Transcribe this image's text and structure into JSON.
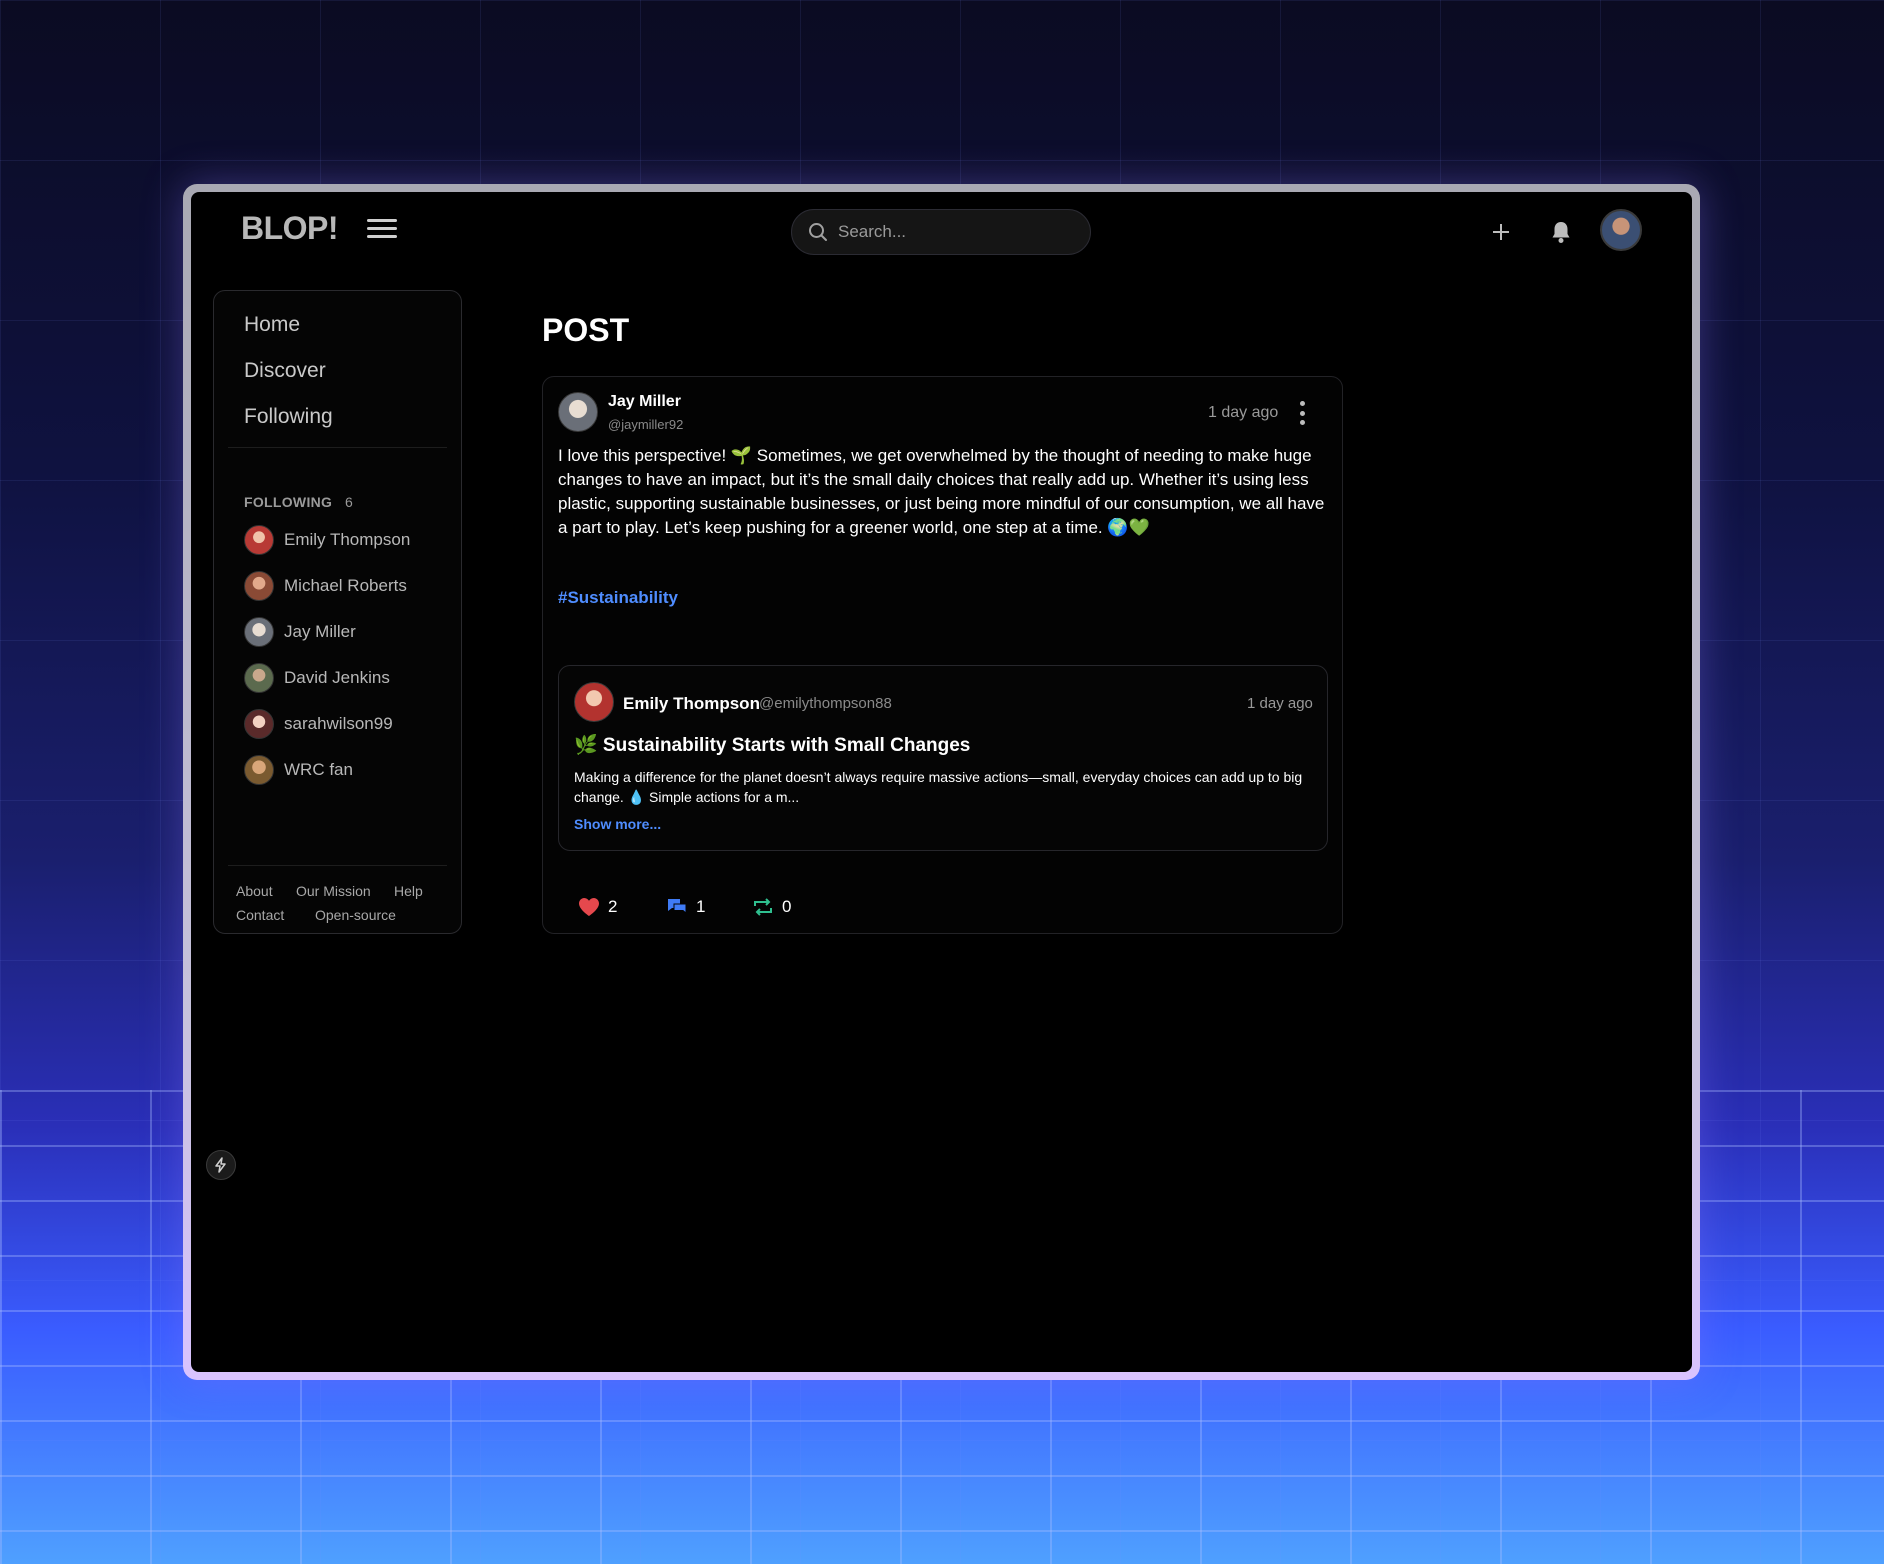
{
  "app": {
    "logo": "BLOP!"
  },
  "search": {
    "placeholder": "Search..."
  },
  "nav": {
    "items": [
      {
        "label": "Home"
      },
      {
        "label": "Discover"
      },
      {
        "label": "Following"
      }
    ]
  },
  "following": {
    "heading": "FOLLOWING",
    "count": "6",
    "users": [
      {
        "name": "Emily Thompson"
      },
      {
        "name": "Michael Roberts"
      },
      {
        "name": "Jay Miller"
      },
      {
        "name": "David Jenkins"
      },
      {
        "name": "sarahwilson99"
      },
      {
        "name": "WRC fan"
      }
    ]
  },
  "footer": {
    "links": [
      "About",
      "Our Mission",
      "Help",
      "Contact",
      "Open-source"
    ]
  },
  "page": {
    "title": "POST"
  },
  "post": {
    "author": "Jay Miller",
    "handle": "@jaymiller92",
    "time": "1 day ago",
    "body": "I love this perspective! 🌱 Sometimes, we get overwhelmed by the thought of needing to make huge changes to have an impact, but it’s the small daily choices that really add up. Whether it’s using less plastic, supporting sustainable businesses, or just being more mindful of our consumption, we all have a part to play. Let’s keep pushing for a greener world, one step at a time. 🌍💚",
    "hashtag": "#Sustainability",
    "quoted": {
      "author": "Emily Thompson",
      "handle": "@emilythompson88",
      "time": "1 day ago",
      "title": "🌿 Sustainability Starts with Small Changes",
      "excerpt": "Making a difference for the planet doesn’t always require massive actions—small, everyday choices can add up to big change. 💧 Simple actions for a m...",
      "show_more": "Show more..."
    },
    "actions": {
      "likes": "2",
      "comments": "1",
      "reposts": "0"
    }
  },
  "colors": {
    "accent_link": "#4f8dff",
    "like": "#e5484d",
    "comment": "#3f7bf5",
    "repost": "#2fbf8f"
  },
  "icons": [
    "menu-icon",
    "search-icon",
    "plus-icon",
    "bell-icon",
    "more-vertical-icon",
    "heart-icon",
    "comment-icon",
    "repost-icon",
    "bolt-icon"
  ]
}
